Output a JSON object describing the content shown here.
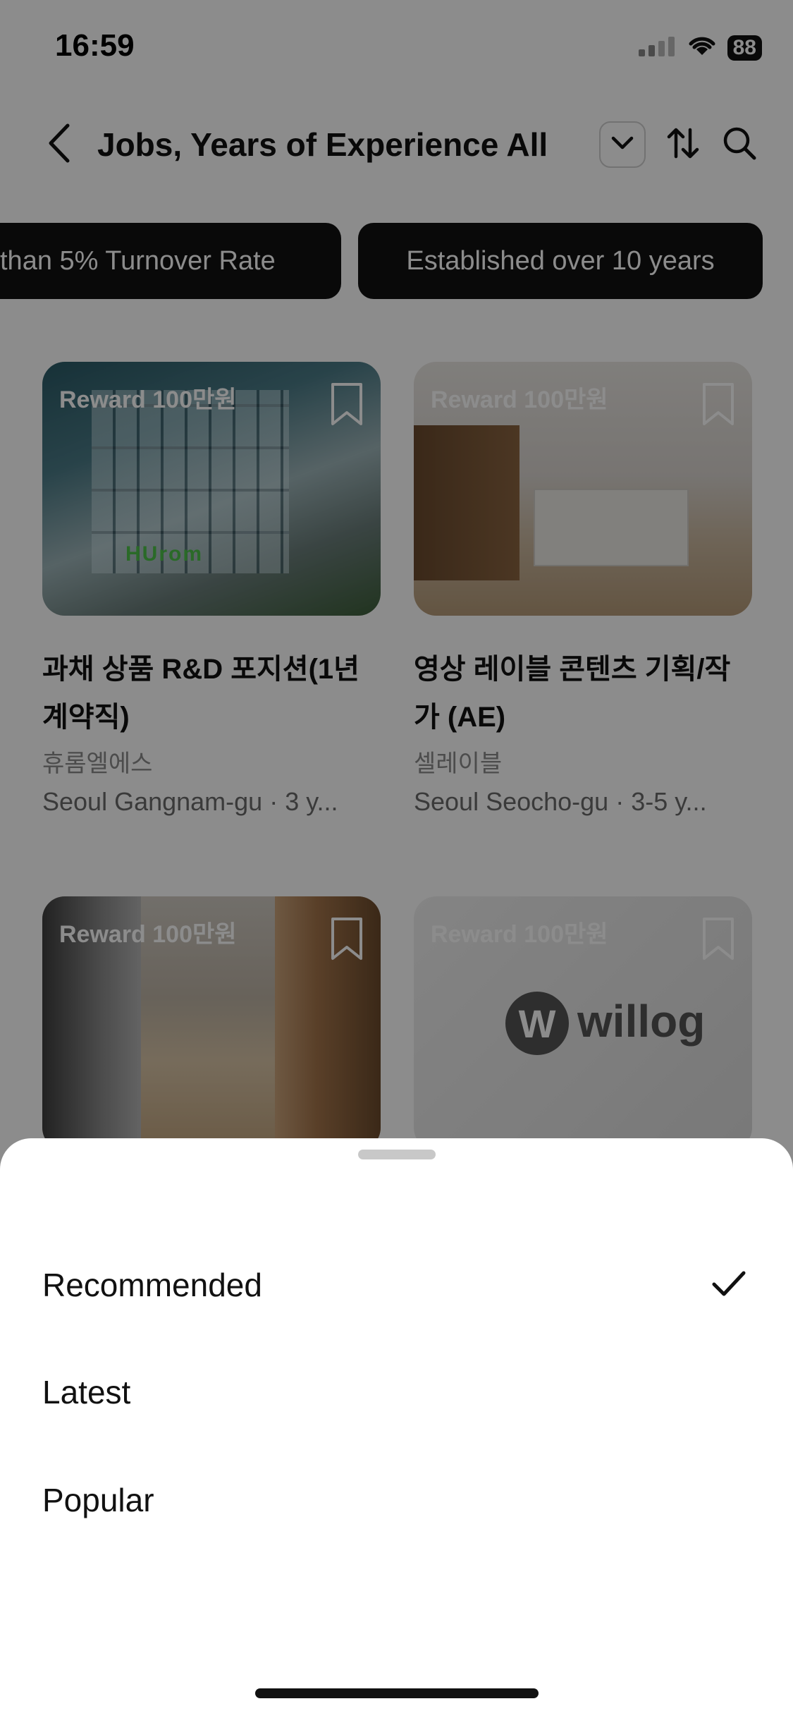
{
  "status_bar": {
    "time": "16:59",
    "battery": "88"
  },
  "header": {
    "title": "Jobs, Years of Experience All"
  },
  "filters": [
    {
      "label": "than 5% Turnover Rate"
    },
    {
      "label": "Established over 10 years"
    }
  ],
  "cards": [
    {
      "reward": "Reward 100만원",
      "brand": "HUrom",
      "title": "과채 상품 R&D 포지션(1년 계약직)",
      "company": "휴롬엘에스",
      "meta": "Seoul Gangnam-gu · 3 y..."
    },
    {
      "reward": "Reward 100만원",
      "title": "영상 레이블 콘텐츠 기획/작가 (AE)",
      "company": "셀레이블",
      "meta": "Seoul Seocho-gu · 3-5 y..."
    },
    {
      "reward": "Reward 100만원"
    },
    {
      "reward": "Reward 100만원",
      "logo_text": "willog"
    }
  ],
  "sort_sheet": {
    "options": [
      "Recommended",
      "Latest",
      "Popular"
    ],
    "selected": "Recommended"
  },
  "icons": [
    "chevron-left-icon",
    "chevron-down-icon",
    "sort-icon",
    "search-icon",
    "bookmark-icon",
    "check-icon",
    "wifi-icon",
    "signal-icon"
  ]
}
